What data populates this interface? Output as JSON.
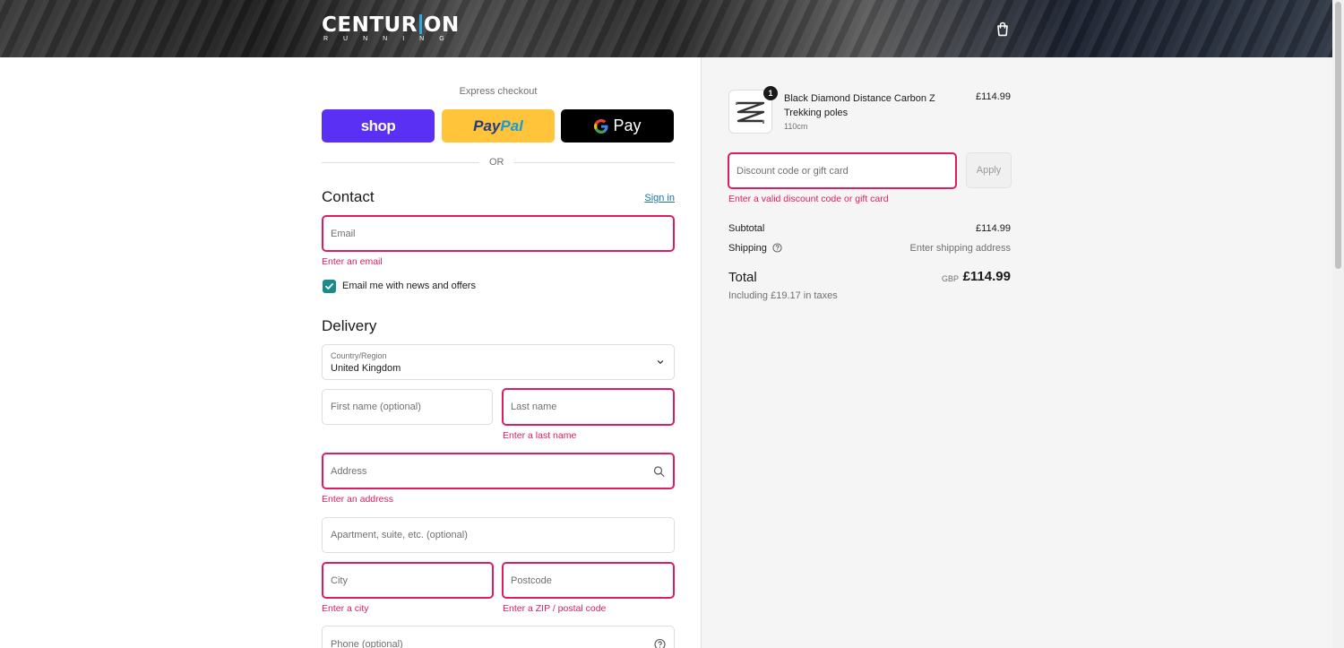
{
  "header": {
    "logo_main": "CENTURION",
    "logo_sub": "RUNNING",
    "cart_icon": "shopping-bag-icon"
  },
  "express": {
    "title": "Express checkout",
    "shop_label": "shop",
    "paypal_label_1": "Pay",
    "paypal_label_2": "Pal",
    "gpay_label": "Pay",
    "or_label": "OR"
  },
  "contact": {
    "title": "Contact",
    "signin_label": "Sign in",
    "email_placeholder": "Email",
    "email_error": "Enter an email",
    "newsletter_label": "Email me with news and offers",
    "newsletter_checked": true
  },
  "delivery": {
    "title": "Delivery",
    "country_label": "Country/Region",
    "country_value": "United Kingdom",
    "first_name_placeholder": "First name (optional)",
    "last_name_placeholder": "Last name",
    "last_name_error": "Enter a last name",
    "address_placeholder": "Address",
    "address_error": "Enter an address",
    "apartment_placeholder": "Apartment, suite, etc. (optional)",
    "city_placeholder": "City",
    "city_error": "Enter a city",
    "postcode_placeholder": "Postcode",
    "postcode_error": "Enter a ZIP / postal code",
    "phone_placeholder": "Phone (optional)"
  },
  "summary": {
    "product": {
      "quantity": "1",
      "name": "Black Diamond Distance Carbon Z Trekking poles",
      "variant": "110cm",
      "price": "£114.99"
    },
    "discount_placeholder": "Discount code or gift card",
    "apply_label": "Apply",
    "discount_error": "Enter a valid discount code or gift card",
    "subtotal_label": "Subtotal",
    "subtotal_value": "£114.99",
    "shipping_label": "Shipping",
    "shipping_value": "Enter shipping address",
    "total_label": "Total",
    "total_currency": "GBP",
    "total_value": "£114.99",
    "tax_note": "Including £19.17 in taxes"
  },
  "colors": {
    "error": "#dd1d5e",
    "shop": "#5a31f4",
    "paypal": "#ffc439",
    "link": "#1773b0"
  }
}
